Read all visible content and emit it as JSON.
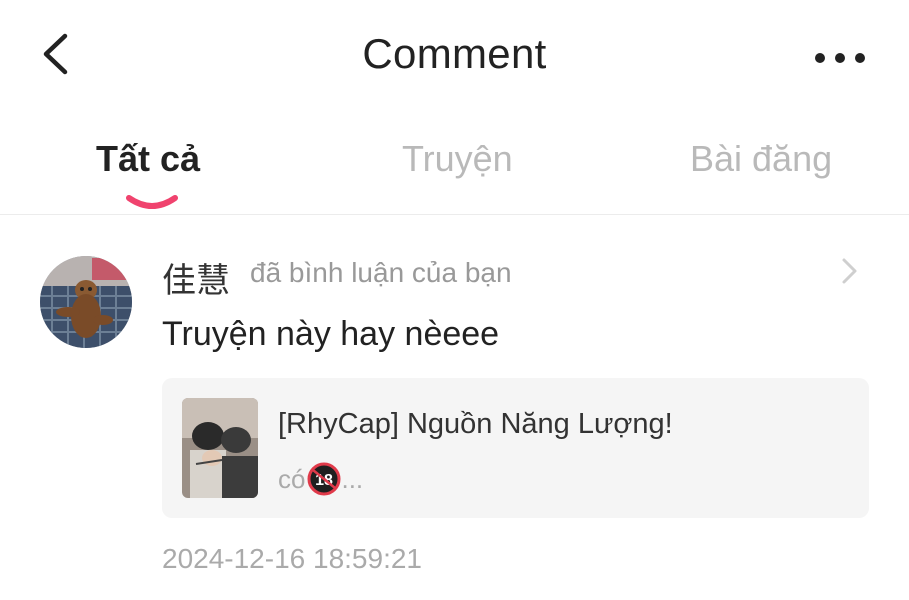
{
  "header": {
    "title": "Comment",
    "back_icon": "chevron-left-icon",
    "more_icon": "more-horizontal-icon"
  },
  "tabs": [
    {
      "label": "Tất cả",
      "active": true
    },
    {
      "label": "Truyện",
      "active": false
    },
    {
      "label": "Bài đăng",
      "active": false
    }
  ],
  "colors": {
    "accent": "#f0436e",
    "text_primary": "#222222",
    "text_secondary": "#999999",
    "card_bg": "#f5f5f5"
  },
  "comment": {
    "username": "佳慧",
    "action": "đã bình luận của bạn",
    "text": "Truyện này hay nèeee",
    "story": {
      "title": "[RhyCap] Nguồn Năng Lượng!",
      "subtitle_prefix": "có",
      "badge": "18",
      "subtitle_suffix": "..."
    },
    "timestamp": "2024-12-16 18:59:21"
  }
}
